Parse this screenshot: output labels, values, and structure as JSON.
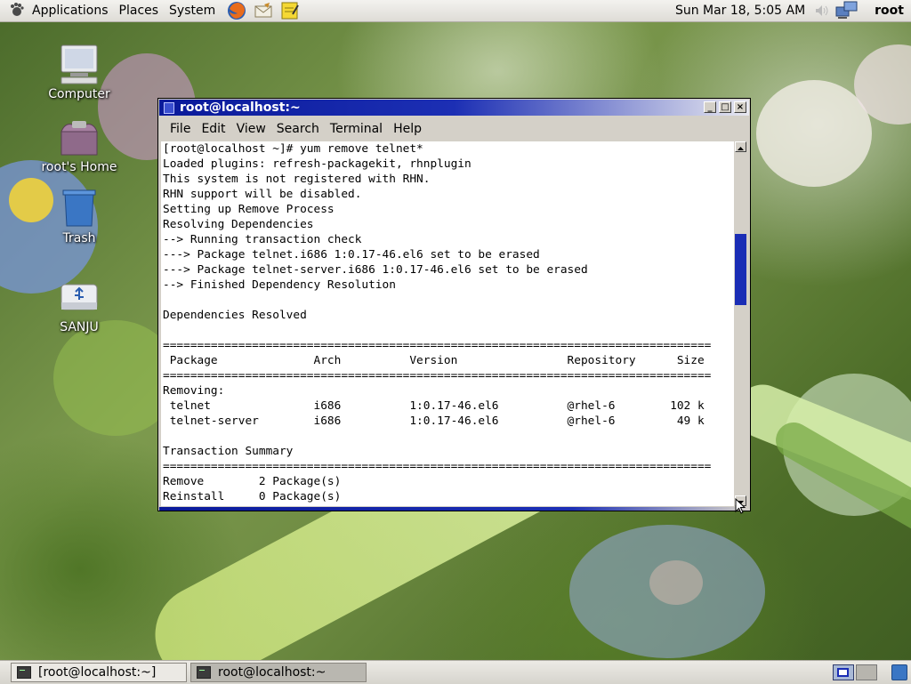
{
  "top_panel": {
    "menus": [
      "Applications",
      "Places",
      "System"
    ],
    "clock": "Sun Mar 18,  5:05 AM",
    "user": "root",
    "launchers": [
      "firefox-icon",
      "mail-icon",
      "notes-icon"
    ]
  },
  "desktop": {
    "icons": [
      {
        "label": "Computer",
        "icon": "computer-icon"
      },
      {
        "label": "root's Home",
        "icon": "home-folder-icon"
      },
      {
        "label": "Trash",
        "icon": "trash-icon"
      },
      {
        "label": "SANJU",
        "icon": "usb-drive-icon"
      }
    ]
  },
  "terminal": {
    "title": "root@localhost:~",
    "menus": [
      "File",
      "Edit",
      "View",
      "Search",
      "Terminal",
      "Help"
    ],
    "lines": [
      "[root@localhost ~]# yum remove telnet*",
      "Loaded plugins: refresh-packagekit, rhnplugin",
      "This system is not registered with RHN.",
      "RHN support will be disabled.",
      "Setting up Remove Process",
      "Resolving Dependencies",
      "--> Running transaction check",
      "---> Package telnet.i686 1:0.17-46.el6 set to be erased",
      "---> Package telnet-server.i686 1:0.17-46.el6 set to be erased",
      "--> Finished Dependency Resolution",
      "",
      "Dependencies Resolved",
      "",
      "================================================================================",
      " Package              Arch          Version                Repository      Size",
      "================================================================================",
      "Removing:",
      " telnet               i686          1:0.17-46.el6          @rhel-6        102 k",
      " telnet-server        i686          1:0.17-46.el6          @rhel-6         49 k",
      "",
      "Transaction Summary",
      "================================================================================",
      "Remove        2 Package(s)",
      "Reinstall     0 Package(s)"
    ]
  },
  "taskbar": {
    "tasks": [
      {
        "label": "[root@localhost:~]"
      },
      {
        "label": "root@localhost:~"
      }
    ]
  },
  "colors": {
    "titlebar": "#1c2fb4",
    "panel": "#dedcd6"
  }
}
